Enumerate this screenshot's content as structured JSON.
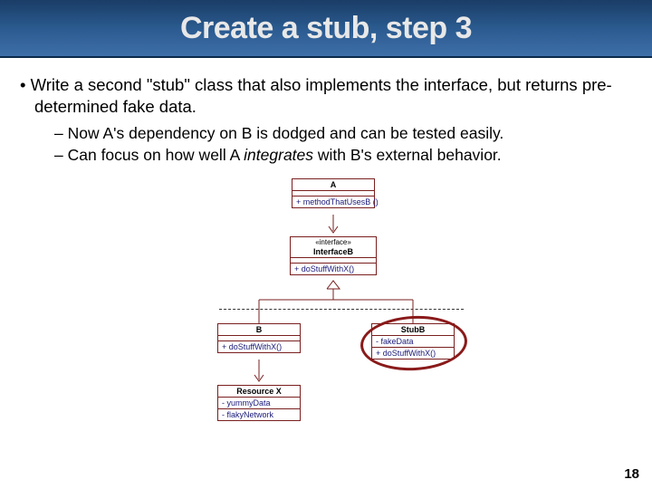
{
  "slide": {
    "title": "Create a stub, step 3",
    "page_number": "18"
  },
  "bullets": {
    "main": "Write a second \"stub\" class that also implements the interface, but returns pre-determined fake data.",
    "sub1_a": "Now A's dependency on B is dodged and can be tested easily.",
    "sub2_a": "Can focus on how well A ",
    "sub2_em": "integrates",
    "sub2_b": " with B's external behavior."
  },
  "uml": {
    "A": {
      "name": "A",
      "op": "+ methodThatUsesB ()"
    },
    "InterfaceB": {
      "stereo": "«interface»",
      "name": "InterfaceB",
      "op": "+ doStuffWithX()"
    },
    "B": {
      "name": "B",
      "op": "+ doStuffWithX()"
    },
    "StubB": {
      "name": "StubB",
      "attr": "- fakeData",
      "op": "+ doStuffWithX()"
    },
    "ResourceX": {
      "name": "Resource X",
      "attr1": "- yummyData",
      "attr2": "- flakyNetwork"
    }
  }
}
